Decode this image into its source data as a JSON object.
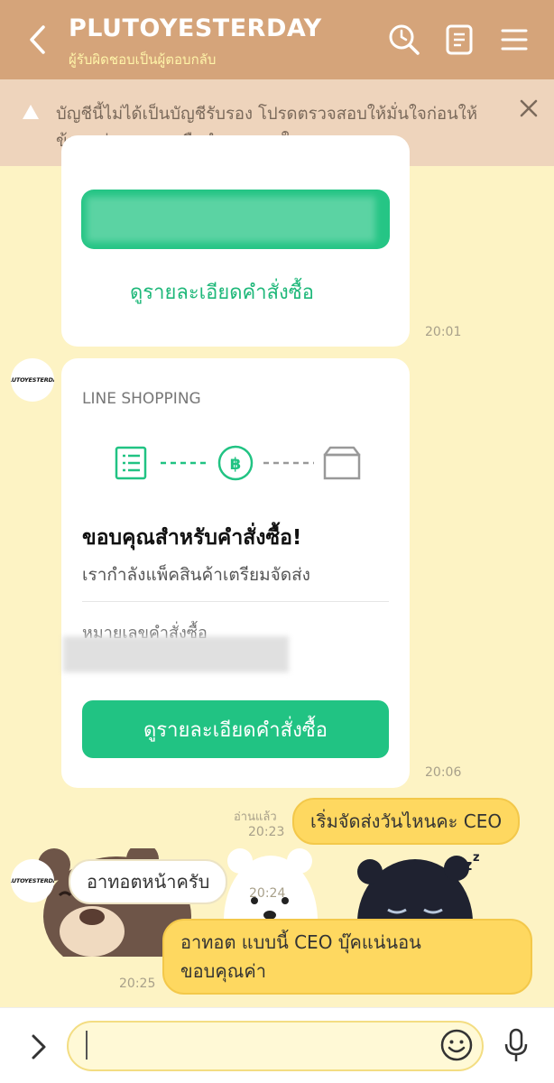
{
  "header": {
    "title": "PLUTOYESTERDAY",
    "subtitle": "ผู้รับผิดชอบเป็นผู้ตอบกลับ"
  },
  "banner": {
    "text": "บัญชีนี้ไม่ได้เป็นบัญชีรับรอง โปรดตรวจสอบให้มั่นใจก่อนให้ข้อมูลส่วนบุคคลหรือทำธุรกรรมใดๆ"
  },
  "messages": {
    "card1": {
      "link": "ดูรายละเอียดคำสั่งซื้อ",
      "time": "20:01"
    },
    "avatar_label": "PLUTOYESTERDAY",
    "card2": {
      "brand": "LINE SHOPPING",
      "heading": "ขอบคุณสำหรับคำสั่งซื้อ!",
      "subtext": "เรากำลังแพ็คสินค้าเตรียมจัดส่ง",
      "order_label": "หมายเลขคำสั่งซื้อ",
      "button": "ดูรายละเอียดคำสั่งซื้อ",
      "time": "20:06"
    },
    "mine1": {
      "read": "อ่านแล้ว",
      "time": "20:23",
      "text": "เริ่มจัดส่งวันไหนคะ CEO"
    },
    "theirs1": {
      "text": "อาทอตหน้าครับ",
      "time": "20:24"
    },
    "mine2": {
      "line1": "อาทอต แบบนี้ CEO บุ๊คแน่นอน",
      "line2": "ขอบคุณค่า",
      "time": "20:25"
    }
  },
  "colors": {
    "header": "#d5a47a",
    "banner": "#eed4bc",
    "chat_bg": "#fdf3c4",
    "line_green": "#21c383",
    "my_bubble": "#fed860"
  }
}
